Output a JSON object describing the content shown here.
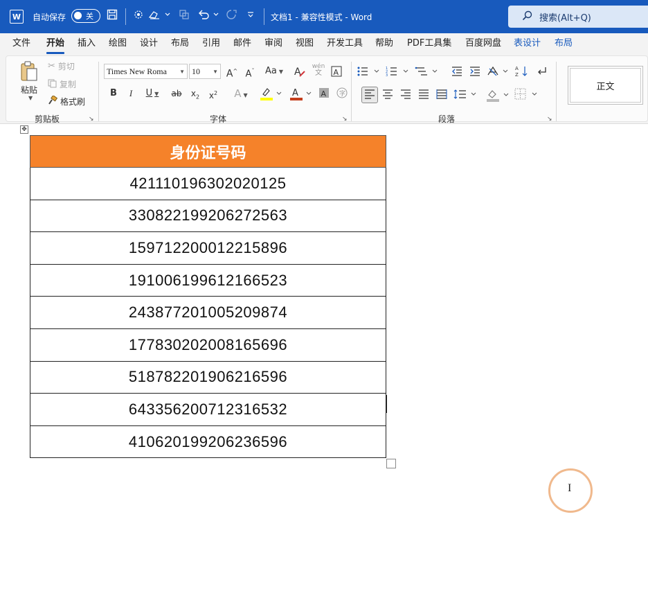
{
  "titlebar": {
    "app_logo": "W",
    "autosave_label": "自动保存",
    "autosave_state": "关",
    "doc_title": "文档1  -  兼容性模式  -  Word",
    "search_placeholder": "搜索(Alt+Q)",
    "icons": [
      "word-logo-icon",
      "save-icon",
      "ink-icon",
      "ink-draw-icon",
      "touch-mode-icon",
      "undo-icon",
      "redo-icon",
      "customize-qat-icon",
      "search-icon"
    ]
  },
  "menu": {
    "tabs": [
      "文件",
      "开始",
      "插入",
      "绘图",
      "设计",
      "布局",
      "引用",
      "邮件",
      "审阅",
      "视图",
      "开发工具",
      "帮助",
      "PDF工具集",
      "百度网盘",
      "表设计",
      "布局"
    ],
    "active_index": 1,
    "context_tabs": [
      14,
      15
    ]
  },
  "ribbon": {
    "clipboard": {
      "paste": "粘贴",
      "cut": "剪切",
      "copy": "复制",
      "format_painter": "格式刷",
      "label": "剪贴板"
    },
    "font": {
      "name": "Times New Roma",
      "size": "10",
      "label": "字体",
      "pinyin_top": "wén",
      "pinyin_bottom": "文"
    },
    "paragraph": {
      "label": "段落"
    },
    "styles": {
      "normal": "正文"
    }
  },
  "table": {
    "header": "身份证号码",
    "header_color": "#f5822a",
    "rows": [
      "421110196302020125",
      "330822199206272563",
      "159712200012215896",
      "191006199612166523",
      "243877201005209874",
      "177830202008165696",
      "518782201906216596",
      "643356200712316532",
      "410620199206236596"
    ]
  },
  "colors": {
    "title_bar": "#185abd",
    "highlight_yellow": "#ffff00",
    "font_color_red": "#c43e1c",
    "cursor_ring": "#f0b98d"
  }
}
